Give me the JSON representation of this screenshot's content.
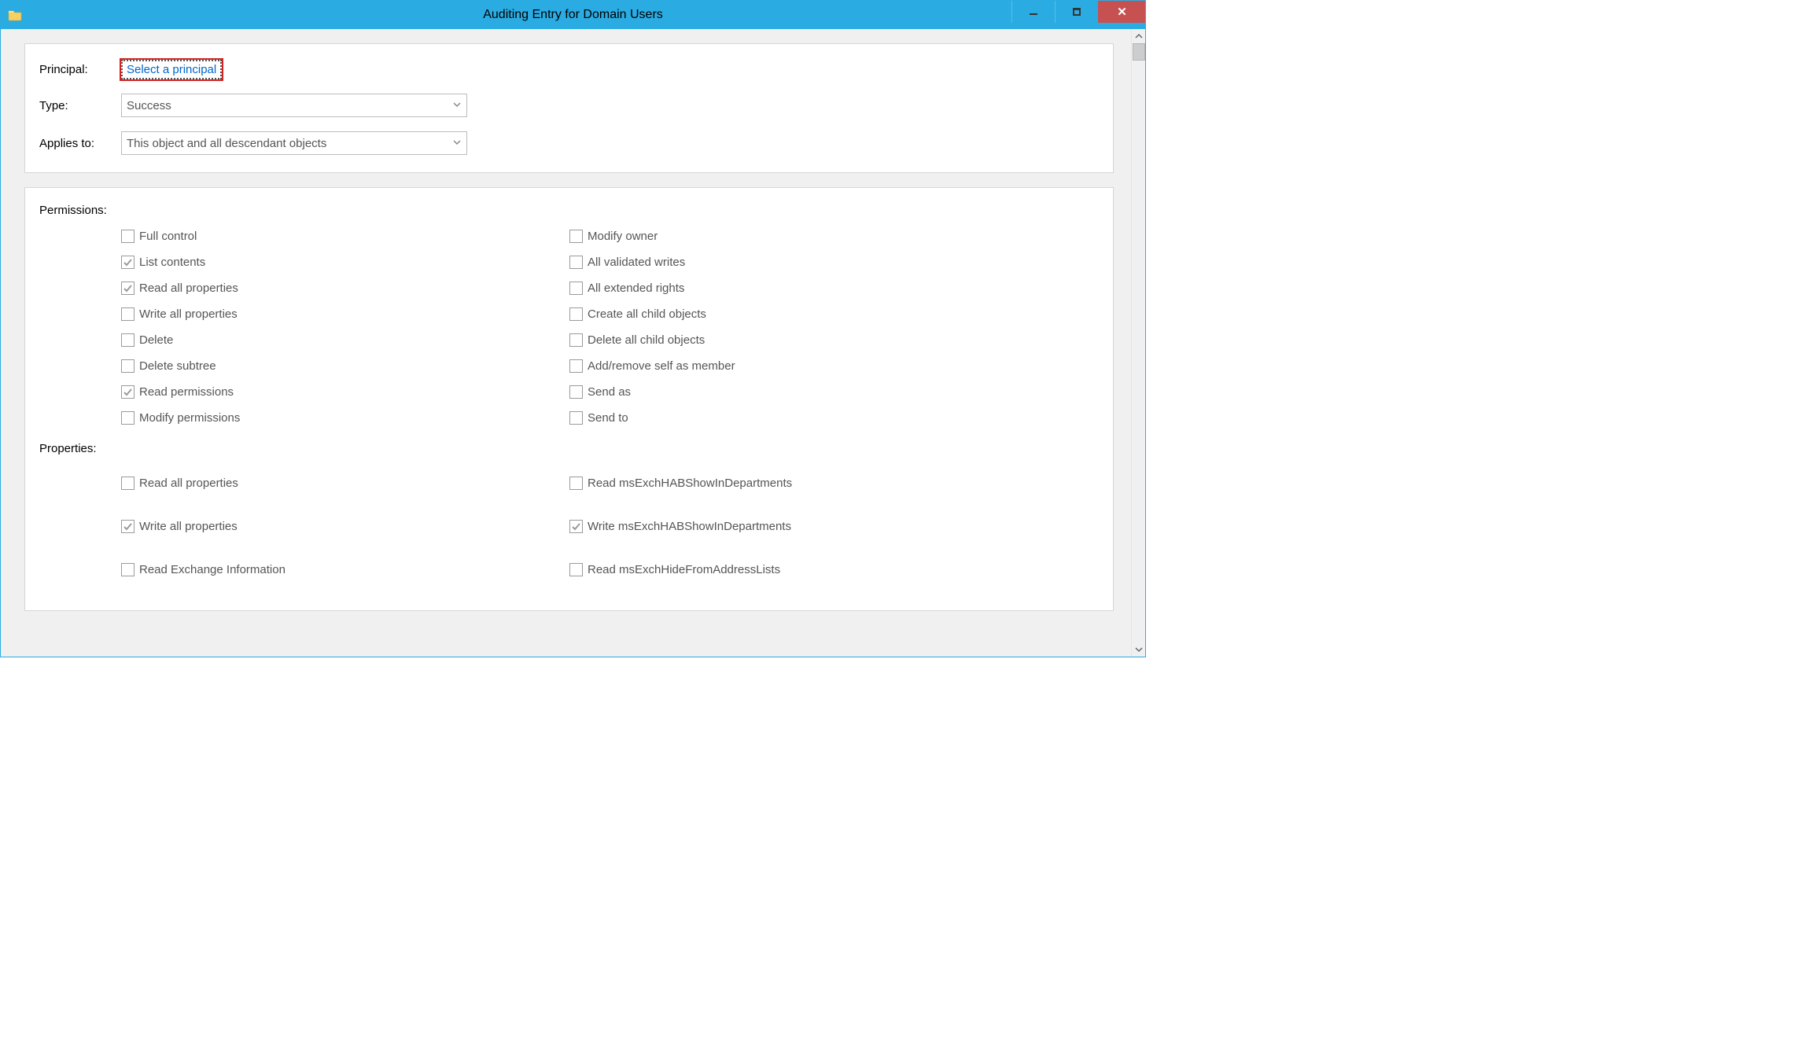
{
  "title": "Auditing Entry for Domain Users",
  "form": {
    "principal": {
      "label": "Principal:",
      "link": "Select a principal"
    },
    "type": {
      "label": "Type:",
      "value": "Success"
    },
    "applies_to": {
      "label": "Applies to:",
      "value": "This object and all descendant objects"
    }
  },
  "permissions_section_label": "Permissions:",
  "permissions_left": [
    {
      "label": "Full control",
      "checked": false
    },
    {
      "label": "List contents",
      "checked": true
    },
    {
      "label": "Read all properties",
      "checked": true
    },
    {
      "label": "Write all properties",
      "checked": false
    },
    {
      "label": "Delete",
      "checked": false
    },
    {
      "label": "Delete subtree",
      "checked": false
    },
    {
      "label": "Read permissions",
      "checked": true
    },
    {
      "label": "Modify permissions",
      "checked": false
    }
  ],
  "permissions_right": [
    {
      "label": "Modify owner",
      "checked": false
    },
    {
      "label": "All validated writes",
      "checked": false
    },
    {
      "label": "All extended rights",
      "checked": false
    },
    {
      "label": "Create all child objects",
      "checked": false
    },
    {
      "label": "Delete all child objects",
      "checked": false
    },
    {
      "label": "Add/remove self as member",
      "checked": false
    },
    {
      "label": "Send as",
      "checked": false
    },
    {
      "label": "Send to",
      "checked": false
    }
  ],
  "properties_section_label": "Properties:",
  "properties_left": [
    {
      "label": "Read all properties",
      "checked": false
    },
    {
      "label": "Write all properties",
      "checked": true
    },
    {
      "label": "Read Exchange Information",
      "checked": false
    }
  ],
  "properties_right": [
    {
      "label": "Read msExchHABShowInDepartments",
      "checked": false
    },
    {
      "label": "Write msExchHABShowInDepartments",
      "checked": true
    },
    {
      "label": "Read msExchHideFromAddressLists",
      "checked": false
    }
  ]
}
